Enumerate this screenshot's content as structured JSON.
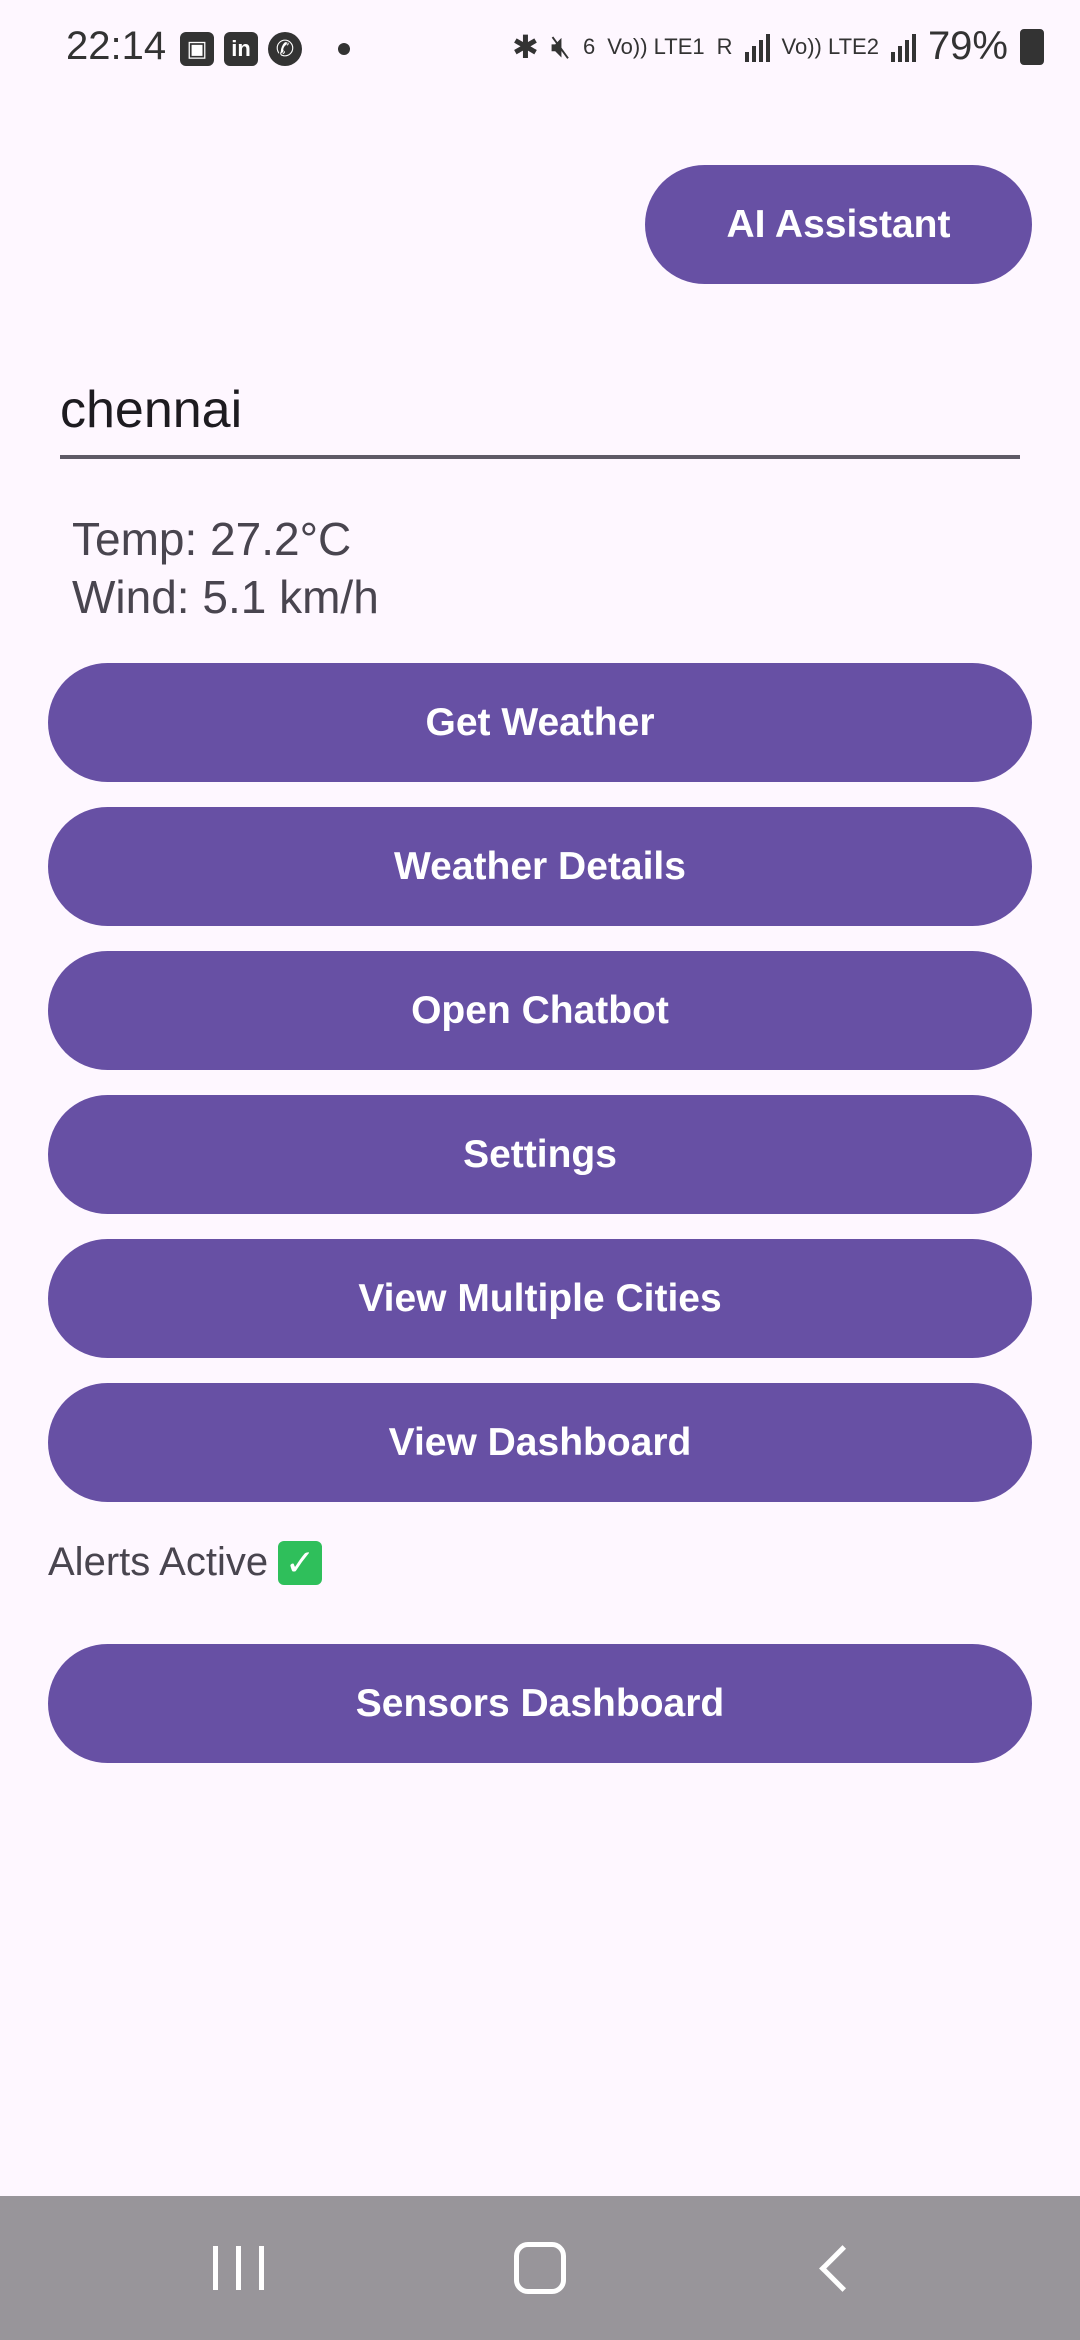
{
  "status_bar": {
    "time": "22:14",
    "left_icons": [
      "gallery-icon",
      "linkedin-icon",
      "phone-app-icon",
      "notification-dot"
    ],
    "right_icons": [
      "bluetooth-icon",
      "mute-icon",
      "wifi-icon",
      "lte1-signal-icon",
      "lte2-signal-icon",
      "battery-icon"
    ],
    "wifi_label": "6",
    "lte1_label": "Vo)) LTE1",
    "roaming_label": "R",
    "lte2_label": "Vo)) LTE2",
    "battery": "79%"
  },
  "header": {
    "ai_assistant_label": "AI Assistant"
  },
  "search": {
    "city_value": "chennai",
    "placeholder": ""
  },
  "weather": {
    "temp": "Temp: 27.2°C",
    "wind": "Wind: 5.1 km/h"
  },
  "buttons": {
    "get_weather": "Get Weather",
    "weather_details": "Weather Details",
    "open_chatbot": "Open Chatbot",
    "settings": "Settings",
    "view_multiple_cities": "View Multiple Cities",
    "view_dashboard": "View Dashboard",
    "sensors_dashboard": "Sensors Dashboard"
  },
  "alerts": {
    "label": "Alerts Active",
    "icon": "check-mark-icon"
  },
  "colors": {
    "primary": "#6750A4",
    "background": "#FEF7FF",
    "navbar": "#98959A"
  },
  "nav_bar": {
    "items": [
      "recents-icon",
      "home-icon",
      "back-icon"
    ]
  }
}
